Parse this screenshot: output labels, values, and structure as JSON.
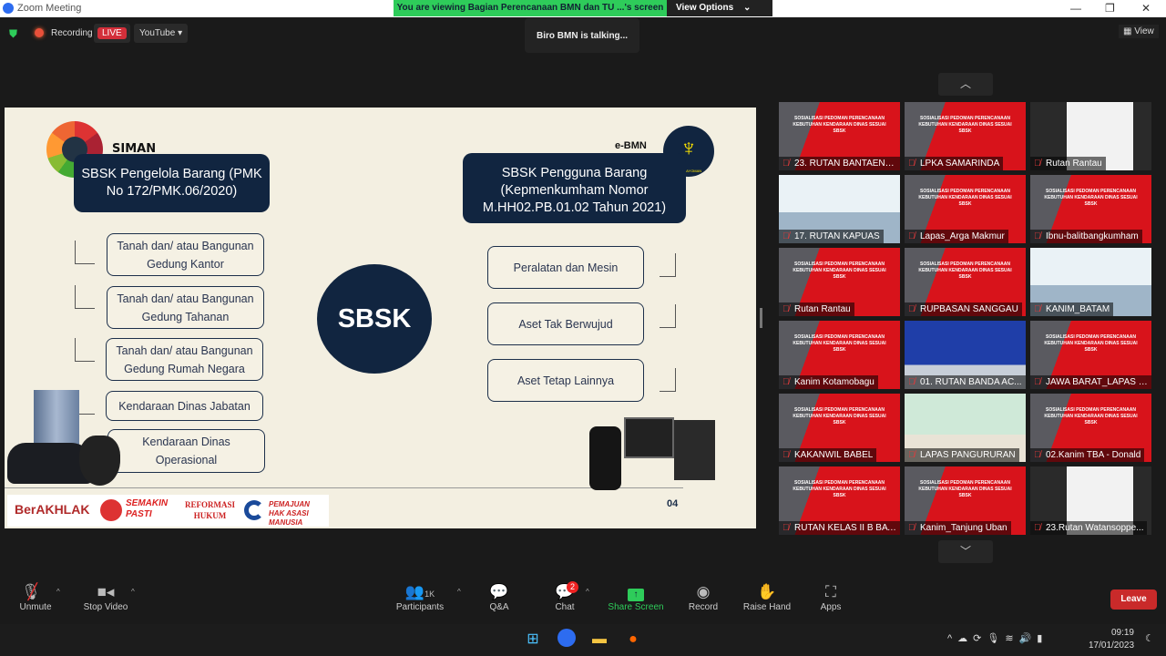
{
  "window": {
    "title": "Zoom Meeting"
  },
  "banner": {
    "message": "You are viewing Bagian Perencanaan BMN dan TU ...'s screen",
    "view_options": "View Options"
  },
  "topbar": {
    "recording": "Recording",
    "live": "LIVE",
    "youtube": "YouTube",
    "view": "View",
    "talking": "Biro BMN is talking..."
  },
  "slide": {
    "left_logo": "SIMAN",
    "right_logo": "e-BMN",
    "right_emblem_text": "PENGAYOMAN",
    "left_header": "SBSK Pengelola Barang (PMK No 172/PMK.06/2020)",
    "right_header": "SBSK Pengguna Barang (Kepmenkumham Nomor M.HH02.PB.01.02 Tahun 2021)",
    "center": "SBSK",
    "left_items": [
      "Tanah dan/ atau Bangunan Gedung Kantor",
      "Tanah dan/ atau Bangunan Gedung Tahanan",
      "Tanah dan/ atau Bangunan Gedung Rumah Negara",
      "Kendaraan Dinas Jabatan",
      "Kendaraan Dinas Operasional"
    ],
    "right_items": [
      "Peralatan dan Mesin",
      "Aset Tak Berwujud",
      "Aset Tetap Lainnya"
    ],
    "page_number": "04",
    "footer_logos": [
      "BerAKHLAK",
      "SEMAKIN PASTI",
      "REFORMASI HUKUM",
      "PEMAJUAN HAK ASASI MANUSIA"
    ]
  },
  "gallery": {
    "slide_text": "SOSIALISASI PEDOMAN PERENCANAAN KEBUTUHAN KENDARAAN DINAS SESUAI SBSK",
    "tiles": [
      {
        "name": "23. RUTAN BANTAENG...",
        "style": "red"
      },
      {
        "name": "LPKA SAMARINDA",
        "style": "red"
      },
      {
        "name": "Rutan Rantau",
        "style": "white"
      },
      {
        "name": "17. RUTAN KAPUAS",
        "style": "room"
      },
      {
        "name": "Lapas_Arga Makmur",
        "style": "red"
      },
      {
        "name": "Ibnu-balitbangkumham",
        "style": "red"
      },
      {
        "name": "Rutan Rantau",
        "style": "red"
      },
      {
        "name": "RUPBASAN SANGGAU",
        "style": "red"
      },
      {
        "name": "KANIM_BATAM",
        "style": "room"
      },
      {
        "name": "Kanim Kotamobagu",
        "style": "red"
      },
      {
        "name": "01. RUTAN BANDA AC...",
        "style": "blue"
      },
      {
        "name": "JAWA BARAT_LAPAS K...",
        "style": "red"
      },
      {
        "name": "KAKANWIL BABEL",
        "style": "red"
      },
      {
        "name": "LAPAS PANGURURAN",
        "style": "green"
      },
      {
        "name": "02.Kanim TBA - Donald",
        "style": "red"
      },
      {
        "name": "RUTAN KELAS II B BAT...",
        "style": "red"
      },
      {
        "name": "Kanim_Tanjung Uban",
        "style": "red"
      },
      {
        "name": "23.Rutan Watansoppe...",
        "style": "white"
      }
    ]
  },
  "toolbar": {
    "unmute": "Unmute",
    "stop_video": "Stop Video",
    "participants": "Participants",
    "participants_count": "1K",
    "qa": "Q&A",
    "chat": "Chat",
    "chat_badge": "2",
    "share": "Share Screen",
    "record": "Record",
    "raise": "Raise Hand",
    "apps": "Apps",
    "leave": "Leave"
  },
  "taskbar": {
    "time": "09:19",
    "date": "17/01/2023"
  },
  "colors": {
    "share_green": "#2ecc5a",
    "leave_red": "#c92a2a",
    "slide_navy": "#112540",
    "live_red": "#d32f3a"
  }
}
